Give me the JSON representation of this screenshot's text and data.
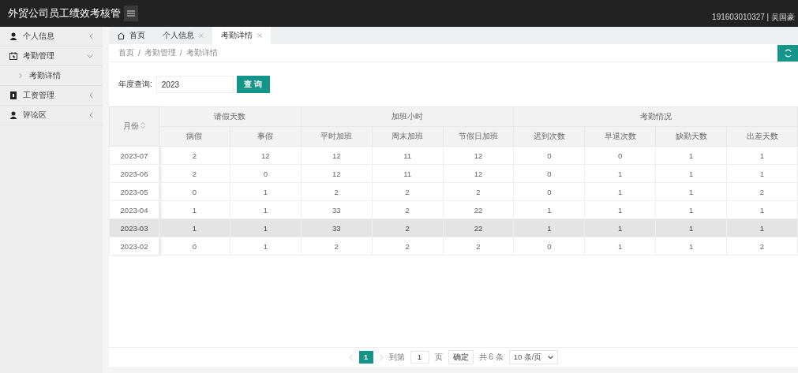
{
  "header": {
    "title": "外贸公司员工绩效考核管",
    "user": "191603010327 | 吴国豪"
  },
  "sidebar": {
    "items": [
      {
        "label": "个人信息",
        "kind": "person",
        "expanded": false
      },
      {
        "label": "考勤管理",
        "kind": "calendar",
        "expanded": true,
        "children": [
          {
            "label": "考勤详情"
          }
        ]
      },
      {
        "label": "工资管理",
        "kind": "book",
        "expanded": false
      },
      {
        "label": "评论区",
        "kind": "person",
        "expanded": false
      }
    ]
  },
  "tabs": [
    {
      "label": "首页",
      "kind": "home",
      "selected": false
    },
    {
      "label": "个人信息",
      "kind": "closable",
      "selected": false
    },
    {
      "label": "考勤详情",
      "kind": "closable",
      "selected": true
    }
  ],
  "breadcrumb": {
    "separator": "/",
    "items": [
      "首页",
      "考勤管理",
      "考勤详情"
    ]
  },
  "search": {
    "label": "年度查询:",
    "value": "2023",
    "button": "查 询"
  },
  "table": {
    "month_header": "月份",
    "groups": [
      {
        "label": "请假天数",
        "columns": [
          "病假",
          "事假"
        ]
      },
      {
        "label": "加班小时",
        "columns": [
          "平时加班",
          "周末加班",
          "节假日加班"
        ]
      },
      {
        "label": "考勤情况",
        "columns": [
          "迟到次数",
          "早退次数",
          "缺勤天数",
          "出差天数"
        ]
      }
    ],
    "rows": [
      {
        "month": "2023-07",
        "cells": [
          "2",
          "12",
          "12",
          "11",
          "12",
          "0",
          "0",
          "1",
          "1"
        ],
        "selected": false
      },
      {
        "month": "2023-06",
        "cells": [
          "2",
          "0",
          "12",
          "11",
          "12",
          "0",
          "1",
          "1",
          "1"
        ],
        "selected": false
      },
      {
        "month": "2023-05",
        "cells": [
          "0",
          "1",
          "2",
          "2",
          "2",
          "0",
          "1",
          "1",
          "2"
        ],
        "selected": false
      },
      {
        "month": "2023-04",
        "cells": [
          "1",
          "1",
          "33",
          "2",
          "22",
          "1",
          "1",
          "1",
          "1"
        ],
        "selected": false
      },
      {
        "month": "2023-03",
        "cells": [
          "1",
          "1",
          "33",
          "2",
          "22",
          "1",
          "1",
          "1",
          "1"
        ],
        "selected": true
      },
      {
        "month": "2023-02",
        "cells": [
          "0",
          "1",
          "2",
          "2",
          "2",
          "0",
          "1",
          "1",
          "2"
        ],
        "selected": false
      }
    ]
  },
  "pagination": {
    "pages": [
      {
        "label": "1",
        "selected": true
      }
    ],
    "goto_label": "到第",
    "goto_value": "1",
    "page_unit": "页",
    "confirm": "确定",
    "total": "共 6 条",
    "page_size": "10 条/页"
  }
}
